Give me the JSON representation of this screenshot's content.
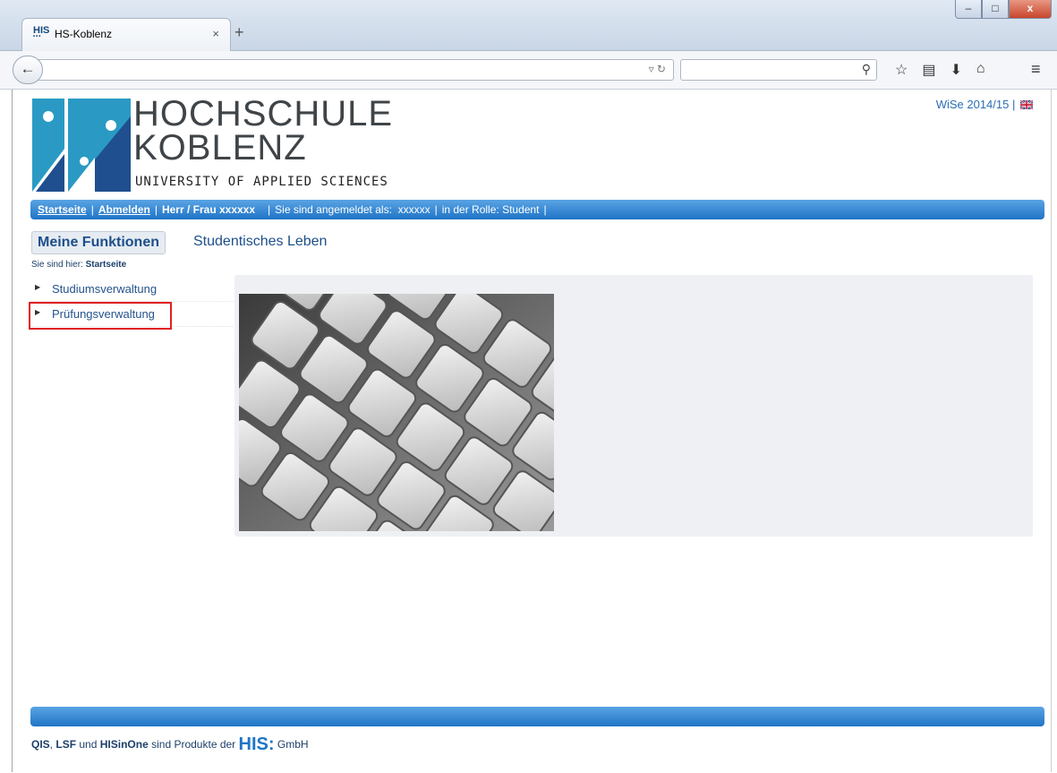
{
  "browser": {
    "tab_icon": "HIS",
    "tab_title": "HS-Koblenz",
    "tab_close": "×",
    "new_tab": "+",
    "window_buttons": [
      "–",
      "□",
      "x"
    ]
  },
  "header": {
    "logo_line1": "HOCHSCHULE",
    "logo_line2": "KOBLENZ",
    "logo_sub": "UNIVERSITY OF APPLIED SCIENCES",
    "semester": "WiSe 2014/15",
    "semester_sep": "|"
  },
  "topnav": {
    "home": "Startseite",
    "logout": "Abmelden",
    "user": "Herr / Frau xxxxxx",
    "logged_in_as_label": "Sie sind angemeldet als:",
    "logged_in_as_value": "xxxxxx",
    "role": "in der Rolle: Student"
  },
  "functions": {
    "active": "Meine Funktionen",
    "other": "Studentisches Leben"
  },
  "breadcrumb": {
    "label": "Sie sind hier:",
    "current": "Startseite"
  },
  "sidebar": {
    "items": [
      {
        "label": "Studiumsverwaltung"
      },
      {
        "label": "Prüfungsverwaltung"
      }
    ]
  },
  "footer": {
    "qis": "QIS",
    "comma": ",",
    "lsf": "LSF",
    "und": "und",
    "hisinone": "HISinOne",
    "text": "sind Produkte der",
    "his": "HIS:",
    "gmbh": "GmbH"
  },
  "icons": [
    "back-icon",
    "reload-icon",
    "search-icon",
    "star-icon",
    "reading-list-icon",
    "download-icon",
    "home-icon",
    "menu-icon",
    "uk-flag-icon",
    "arrow-right-icon"
  ],
  "colors": {
    "accent": "#1f74c6",
    "link": "#24528c",
    "highlight": "#e02020"
  }
}
